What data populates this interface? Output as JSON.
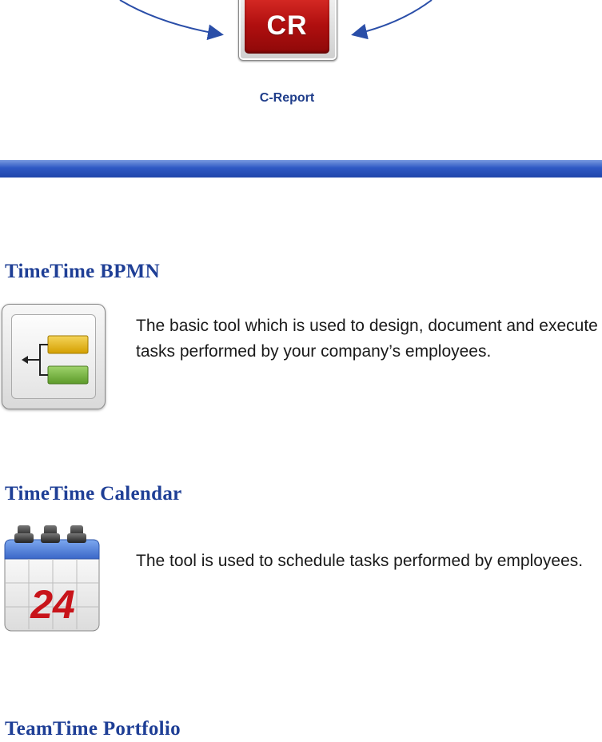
{
  "report": {
    "icon_text": "CR",
    "label": "C-Report"
  },
  "sections": [
    {
      "title": "TimeTime BPMN",
      "description": "The basic tool which is used to design, document and execute tasks performed by your company’s employees.",
      "icon": "bpmn-diagram-icon"
    },
    {
      "title": "TimeTime Calendar",
      "description": "The tool is used to schedule tasks performed by employees.",
      "icon": "calendar-icon",
      "calendar_day": "24"
    },
    {
      "title": "TeamTime Portfolio"
    }
  ],
  "colors": {
    "heading": "#1f3f96",
    "bar": "#2f59c4",
    "report_red": "#c41a14"
  }
}
